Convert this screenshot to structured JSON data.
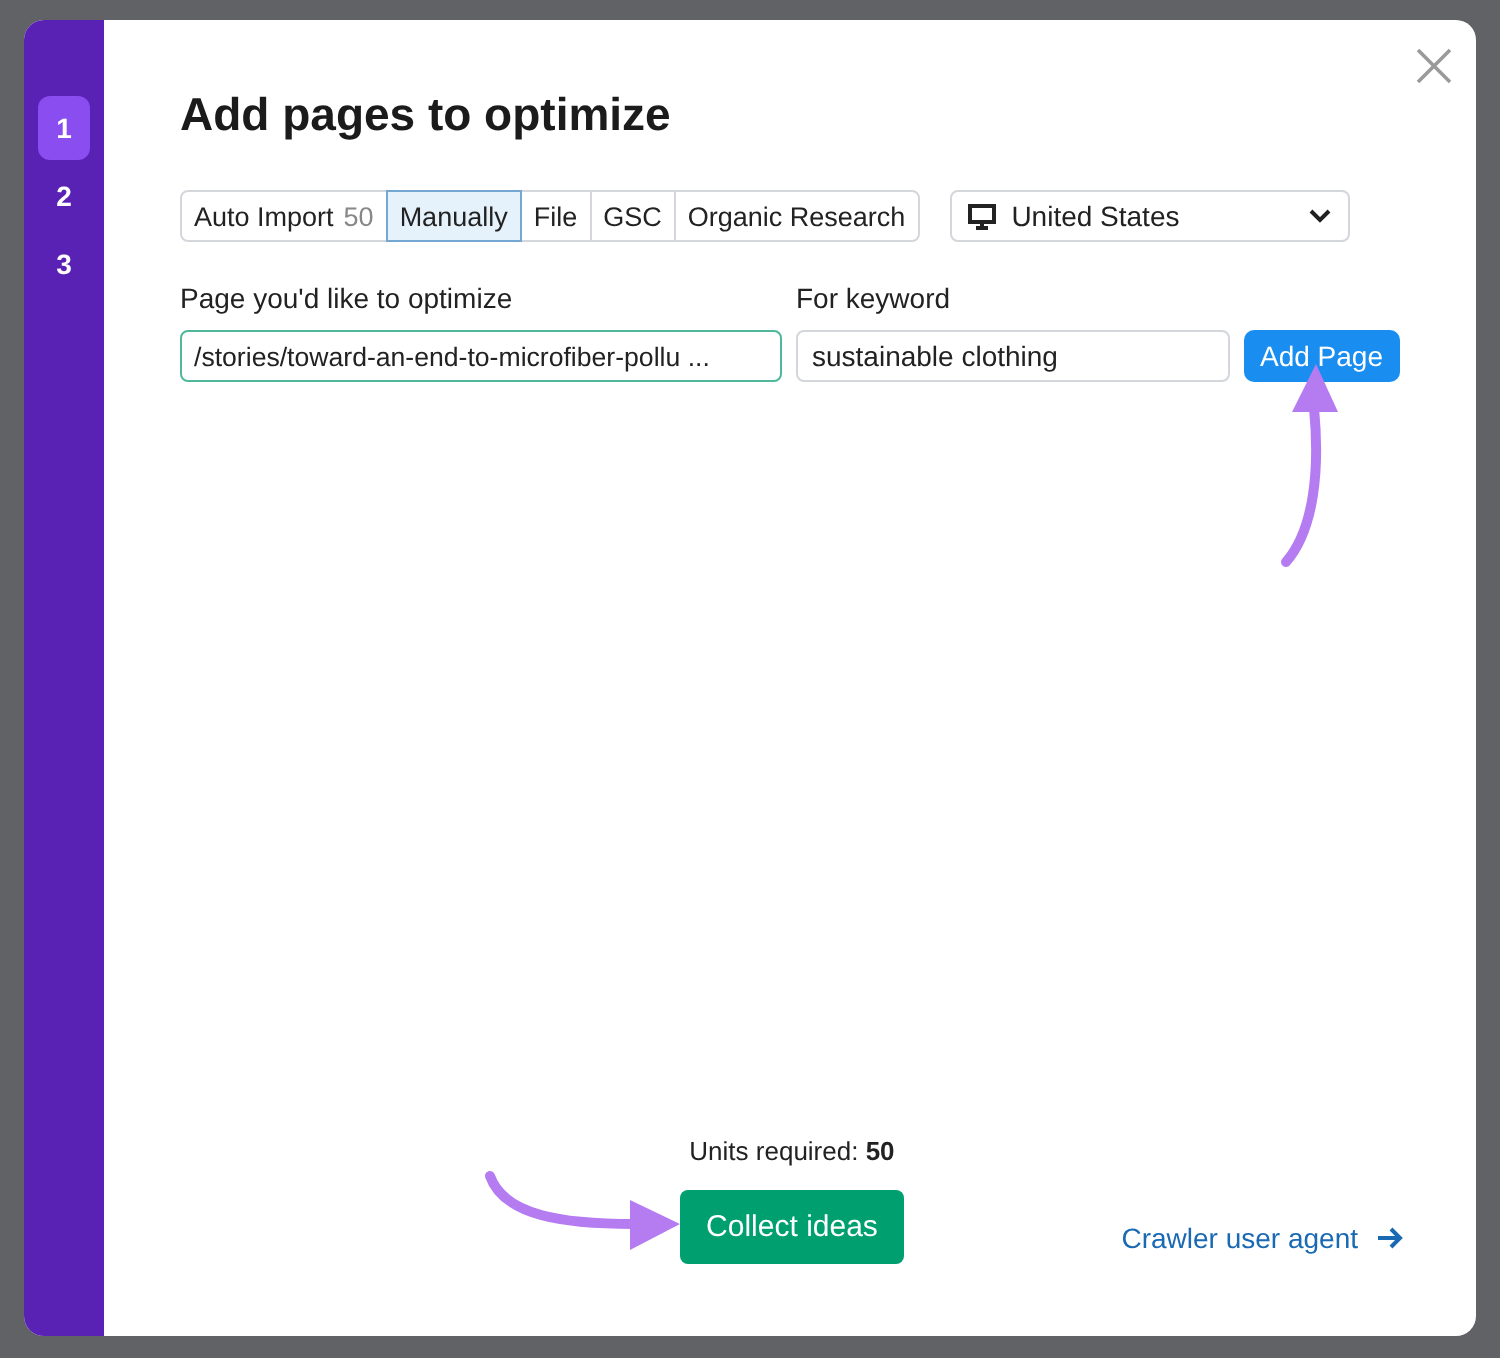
{
  "steps": [
    {
      "label": "1",
      "selected": true
    },
    {
      "label": "2",
      "selected": false
    },
    {
      "label": "3",
      "selected": false
    }
  ],
  "title": "Add pages to optimize",
  "source_tabs": [
    {
      "label": "Auto Import",
      "count": "50",
      "selected": false
    },
    {
      "label": "Manually",
      "selected": true
    },
    {
      "label": "File",
      "selected": false
    },
    {
      "label": "GSC",
      "selected": false
    },
    {
      "label": "Organic Research",
      "selected": false
    }
  ],
  "country": {
    "value": "United States"
  },
  "page_field": {
    "label": "Page you'd like to optimize",
    "value": "/stories/toward-an-end-to-microfiber-pollu ..."
  },
  "keyword_field": {
    "label": "For keyword",
    "value": "sustainable clothing"
  },
  "add_button": "Add Page",
  "units": "Units required: **50**",
  "collect_button": "Collect ideas",
  "crawler_link": "Crawler user agent"
}
